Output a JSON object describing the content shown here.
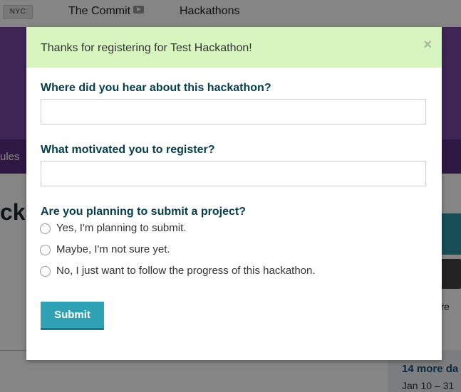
{
  "background": {
    "city_badge": "NYC",
    "nav": {
      "commit": "The Commit",
      "hackathons": "Hackathons"
    },
    "subnav_fragment": "ules",
    "title_fragment": "cka",
    "right_text_fragment": "u're",
    "more_dates": "14 more da",
    "date_range": "Jan 10 – 31"
  },
  "modal": {
    "alert_text": "Thanks for registering for Test Hackathon!",
    "close_label": "×",
    "questions": {
      "hear_about": "Where did you hear about this hackathon?",
      "motivation": "What motivated you to register?",
      "submit_plan": "Are you planning to submit a project?"
    },
    "hear_about_value": "",
    "motivation_value": "",
    "options": [
      "Yes, I'm planning to submit.",
      "Maybe, I'm not sure yet.",
      "No, I just want to follow the progress of this hackathon."
    ],
    "submit_label": "Submit"
  },
  "colors": {
    "alert_bg": "#d8f5c0",
    "submit_bg": "#2fa2b5",
    "label_color": "#063d4c",
    "hero_purple": "#7b4aa8"
  }
}
